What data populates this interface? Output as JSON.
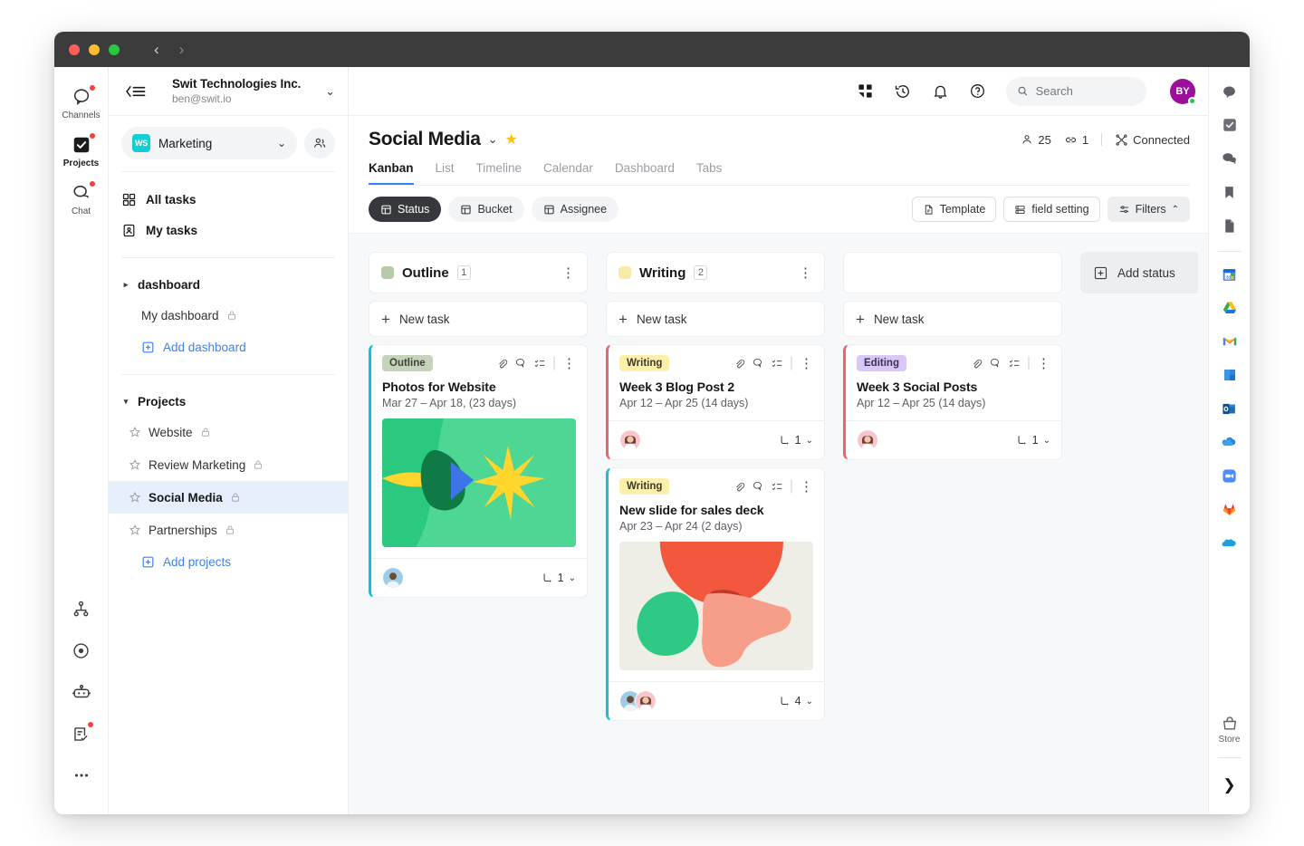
{
  "window": {
    "nav_back": "‹",
    "nav_forward": "›"
  },
  "workspace_header": {
    "company": "Swit Technologies Inc.",
    "email": "ben@swit.io",
    "menu_icon": "hamburger-collapse-icon",
    "chevron": "⌄"
  },
  "rail": {
    "items": [
      {
        "label": "Channels",
        "icon": "channels-icon",
        "has_badge": true,
        "active": false
      },
      {
        "label": "Projects",
        "icon": "projects-icon",
        "has_badge": true,
        "active": true
      },
      {
        "label": "Chat",
        "icon": "chat-icon",
        "has_badge": true,
        "active": false
      }
    ],
    "bottom": [
      {
        "icon": "org-chart-icon",
        "has_badge": false
      },
      {
        "icon": "goal-target-icon",
        "has_badge": false
      },
      {
        "icon": "bot-icon",
        "has_badge": false
      },
      {
        "icon": "approval-icon",
        "has_badge": true
      },
      {
        "icon": "more-dots-icon",
        "has_badge": false
      }
    ]
  },
  "sidebar": {
    "workspace": {
      "badge": "WS",
      "name": "Marketing",
      "chevron": "⌄"
    },
    "people_icon": "people-icon",
    "nav": [
      {
        "label": "All tasks",
        "icon": "grid-icon"
      },
      {
        "label": "My tasks",
        "icon": "clipboard-person-icon"
      }
    ],
    "dashboard_section": {
      "label": "dashboard",
      "caret": "▸",
      "items": [
        {
          "label": "My dashboard",
          "private": true
        }
      ],
      "add_label": "Add dashboard"
    },
    "projects_section": {
      "label": "Projects",
      "caret": "▾",
      "items": [
        {
          "label": "Website",
          "private": true,
          "selected": false
        },
        {
          "label": "Review Marketing",
          "private": true,
          "selected": false
        },
        {
          "label": "Social Media",
          "private": true,
          "selected": true
        },
        {
          "label": "Partnerships",
          "private": true,
          "selected": false
        }
      ],
      "add_label": "Add projects"
    }
  },
  "topbar": {
    "icons": [
      "apps-grid-icon",
      "history-icon",
      "bell-icon",
      "help-icon"
    ],
    "search_placeholder": "Search",
    "search_value": "",
    "avatar_initials": "BY",
    "avatar_color": "#9c0f9c"
  },
  "project": {
    "title": "Social Media",
    "title_chevron": "⌄",
    "starred": true,
    "metrics": {
      "members_icon": "member-icon",
      "members": "25",
      "link_icon": "link-icon",
      "links": "1",
      "connected_icon": "connected-icon",
      "connected_label": "Connected"
    },
    "tabs": [
      {
        "label": "Kanban",
        "active": true
      },
      {
        "label": "List",
        "active": false
      },
      {
        "label": "Timeline",
        "active": false
      },
      {
        "label": "Calendar",
        "active": false
      },
      {
        "label": "Dashboard",
        "active": false
      },
      {
        "label": "Tabs",
        "active": false
      }
    ]
  },
  "toolbar": {
    "groupings": [
      {
        "label": "Status",
        "icon": "status-group-icon",
        "active": true
      },
      {
        "label": "Bucket",
        "icon": "bucket-group-icon",
        "active": false
      },
      {
        "label": "Assignee",
        "icon": "assignee-group-icon",
        "active": false
      }
    ],
    "template_label": "Template",
    "template_icon": "template-icon",
    "field_setting_label": "field setting",
    "field_setting_icon": "field-setting-icon",
    "filters_label": "Filters",
    "filters_icon": "filters-icon",
    "filters_chevron": "⌃"
  },
  "board": {
    "new_task_label": "New task",
    "add_status_label": "Add status",
    "add_status_icon": "add-box-icon",
    "columns": [
      {
        "name": "Outline",
        "count": "1",
        "swatch": "#b7cbab",
        "cards": [
          {
            "tag": "Outline",
            "tag_bg": "#c6d3bb",
            "tag_color": "#3c4338",
            "accent": "#12c2d4",
            "title": "Photos for Website",
            "date": "Mar 27 – Apr 18, (23 days)",
            "has_thumb": true,
            "thumb": "green-burst-art",
            "icons": [
              "attachment-icon",
              "comment-icon",
              "checklist-icon"
            ],
            "assignees": [
              "avatar-man"
            ],
            "subtask_count": "1",
            "subtask_icon": "subtask-icon"
          }
        ]
      },
      {
        "name": "Writing",
        "count": "2",
        "swatch": "#faeaa8",
        "cards": [
          {
            "tag": "Writing",
            "tag_bg": "#fcefab",
            "tag_color": "#3c3a28",
            "accent": "#f4606a",
            "title": "Week 3 Blog Post 2",
            "date": "Apr 12 – Apr 25 (14 days)",
            "has_thumb": false,
            "thumb": "",
            "icons": [
              "attachment-icon",
              "comment-icon",
              "checklist-icon"
            ],
            "assignees": [
              "avatar-woman"
            ],
            "subtask_count": "1",
            "subtask_icon": "subtask-icon"
          },
          {
            "tag": "Writing",
            "tag_bg": "#fcefab",
            "tag_color": "#3c3a28",
            "accent": "#12c2d4",
            "title": "New slide for sales deck",
            "date": "Apr 23 – Apr 24 (2 days)",
            "has_thumb": true,
            "thumb": "coral-shapes-art",
            "icons": [
              "attachment-icon",
              "comment-icon",
              "checklist-icon"
            ],
            "assignees": [
              "avatar-man",
              "avatar-woman"
            ],
            "subtask_count": "4",
            "subtask_icon": "subtask-icon"
          }
        ]
      },
      {
        "name": "",
        "count": "",
        "swatch": "",
        "cards": [
          {
            "tag": "Editing",
            "tag_bg": "#d9c7f7",
            "tag_color": "#3b2f52",
            "accent": "#f4606a",
            "title": "Week 3 Social Posts",
            "date": "Apr 12 – Apr 25 (14 days)",
            "has_thumb": false,
            "thumb": "",
            "icons": [
              "attachment-icon",
              "comment-icon",
              "checklist-icon"
            ],
            "assignees": [
              "avatar-woman"
            ],
            "subtask_count": "1",
            "subtask_icon": "subtask-icon"
          }
        ]
      }
    ]
  },
  "right_rail": {
    "top": [
      "chat-bubble-icon",
      "task-check-icon",
      "chat-double-icon",
      "bookmark-icon",
      "document-icon"
    ],
    "apps": [
      "google-calendar-icon",
      "google-drive-icon",
      "gmail-icon",
      "onenote-icon",
      "outlook-icon",
      "onedrive-icon",
      "zoom-icon",
      "gitlab-icon",
      "salesforce-icon"
    ],
    "store_label": "Store",
    "store_icon": "store-bag-icon",
    "expand_icon": "chevron-right-icon"
  }
}
